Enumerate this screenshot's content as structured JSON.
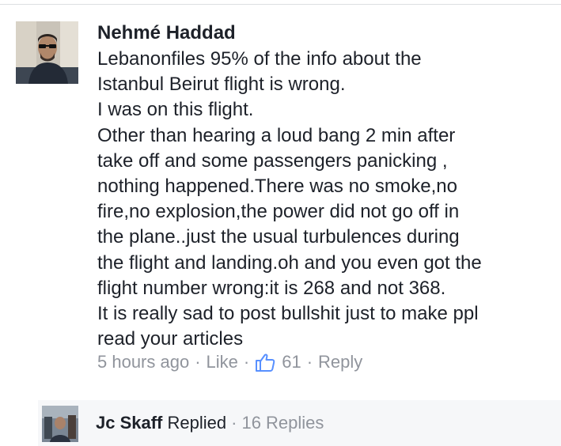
{
  "comment": {
    "author": "Nehmé Haddad",
    "lines": [
      "Lebanonfiles 95% of the info about the",
      "Istanbul Beirut flight is wrong.",
      "I was on this flight.",
      "Other than hearing a loud bang 2 min after",
      "take off and some passengers panicking ,",
      "nothing happened.There was no smoke,no",
      "fire,no explosion,the power did not go off in",
      "the plane..just the usual turbulences during",
      "the flight and landing.oh and you even got the",
      "flight number wrong:it is 268 and not 368.",
      "It is really sad to post bullshit just to make ppl",
      "read your articles"
    ],
    "timestamp": "5 hours ago",
    "like_label": "Like",
    "like_count": "61",
    "reply_label": "Reply",
    "like_icon": "thumbs-up-icon"
  },
  "replies": {
    "replier": "Jc Skaff",
    "verb": "Replied",
    "count_label": "16 Replies"
  },
  "colors": {
    "text": "#1d2129",
    "meta": "#90949c",
    "reply_bg": "#f6f7f9"
  }
}
